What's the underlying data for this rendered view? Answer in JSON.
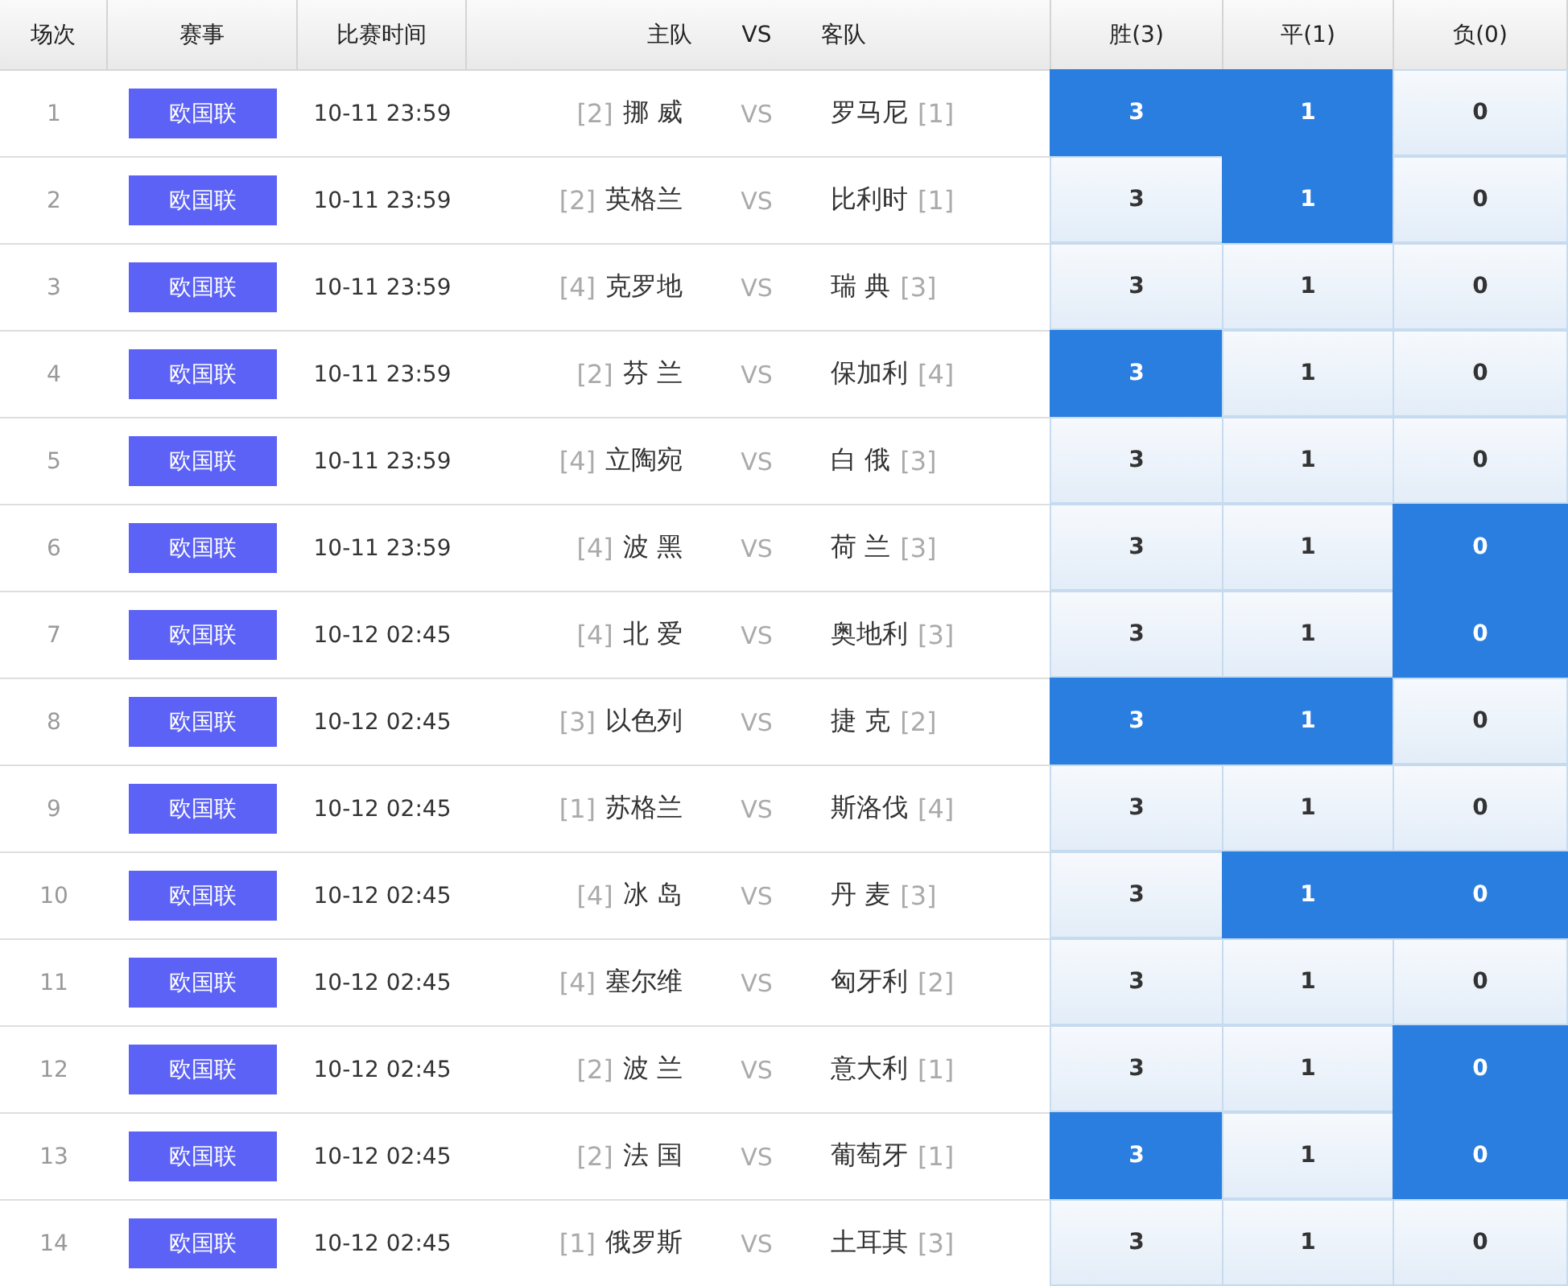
{
  "columns": [
    "场次",
    "赛事",
    "比赛时间",
    "主队",
    "VS",
    "客队",
    "胜(3)",
    "平(1)",
    "负(0)"
  ],
  "rows": [
    {
      "no": "1",
      "league": "欧国联",
      "time": "10-11 23:59",
      "home_rank": "[2]",
      "home": "挪 威",
      "vs": "VS",
      "away": "罗马尼",
      "away_rank": "[1]",
      "options": [
        {
          "label": "3",
          "selected": true
        },
        {
          "label": "1",
          "selected": true
        },
        {
          "label": "0",
          "selected": false
        }
      ]
    },
    {
      "no": "2",
      "league": "欧国联",
      "time": "10-11 23:59",
      "home_rank": "[2]",
      "home": "英格兰",
      "vs": "VS",
      "away": "比利时",
      "away_rank": "[1]",
      "options": [
        {
          "label": "3",
          "selected": false
        },
        {
          "label": "1",
          "selected": true
        },
        {
          "label": "0",
          "selected": false
        }
      ]
    },
    {
      "no": "3",
      "league": "欧国联",
      "time": "10-11 23:59",
      "home_rank": "[4]",
      "home": "克罗地",
      "vs": "VS",
      "away": "瑞 典",
      "away_rank": "[3]",
      "options": [
        {
          "label": "3",
          "selected": false
        },
        {
          "label": "1",
          "selected": false
        },
        {
          "label": "0",
          "selected": false
        }
      ]
    },
    {
      "no": "4",
      "league": "欧国联",
      "time": "10-11 23:59",
      "home_rank": "[2]",
      "home": "芬 兰",
      "vs": "VS",
      "away": "保加利",
      "away_rank": "[4]",
      "options": [
        {
          "label": "3",
          "selected": true
        },
        {
          "label": "1",
          "selected": false
        },
        {
          "label": "0",
          "selected": false
        }
      ]
    },
    {
      "no": "5",
      "league": "欧国联",
      "time": "10-11 23:59",
      "home_rank": "[4]",
      "home": "立陶宛",
      "vs": "VS",
      "away": "白 俄",
      "away_rank": "[3]",
      "options": [
        {
          "label": "3",
          "selected": false
        },
        {
          "label": "1",
          "selected": false
        },
        {
          "label": "0",
          "selected": false
        }
      ]
    },
    {
      "no": "6",
      "league": "欧国联",
      "time": "10-11 23:59",
      "home_rank": "[4]",
      "home": "波 黑",
      "vs": "VS",
      "away": "荷 兰",
      "away_rank": "[3]",
      "options": [
        {
          "label": "3",
          "selected": false
        },
        {
          "label": "1",
          "selected": false
        },
        {
          "label": "0",
          "selected": true
        }
      ]
    },
    {
      "no": "7",
      "league": "欧国联",
      "time": "10-12 02:45",
      "home_rank": "[4]",
      "home": "北 爱",
      "vs": "VS",
      "away": "奥地利",
      "away_rank": "[3]",
      "options": [
        {
          "label": "3",
          "selected": false
        },
        {
          "label": "1",
          "selected": false
        },
        {
          "label": "0",
          "selected": true
        }
      ]
    },
    {
      "no": "8",
      "league": "欧国联",
      "time": "10-12 02:45",
      "home_rank": "[3]",
      "home": "以色列",
      "vs": "VS",
      "away": "捷 克",
      "away_rank": "[2]",
      "options": [
        {
          "label": "3",
          "selected": true
        },
        {
          "label": "1",
          "selected": true
        },
        {
          "label": "0",
          "selected": false
        }
      ]
    },
    {
      "no": "9",
      "league": "欧国联",
      "time": "10-12 02:45",
      "home_rank": "[1]",
      "home": "苏格兰",
      "vs": "VS",
      "away": "斯洛伐",
      "away_rank": "[4]",
      "options": [
        {
          "label": "3",
          "selected": false
        },
        {
          "label": "1",
          "selected": false
        },
        {
          "label": "0",
          "selected": false
        }
      ]
    },
    {
      "no": "10",
      "league": "欧国联",
      "time": "10-12 02:45",
      "home_rank": "[4]",
      "home": "冰 岛",
      "vs": "VS",
      "away": "丹 麦",
      "away_rank": "[3]",
      "options": [
        {
          "label": "3",
          "selected": false
        },
        {
          "label": "1",
          "selected": true
        },
        {
          "label": "0",
          "selected": true
        }
      ]
    },
    {
      "no": "11",
      "league": "欧国联",
      "time": "10-12 02:45",
      "home_rank": "[4]",
      "home": "塞尔维",
      "vs": "VS",
      "away": "匈牙利",
      "away_rank": "[2]",
      "options": [
        {
          "label": "3",
          "selected": false
        },
        {
          "label": "1",
          "selected": false
        },
        {
          "label": "0",
          "selected": false
        }
      ]
    },
    {
      "no": "12",
      "league": "欧国联",
      "time": "10-12 02:45",
      "home_rank": "[2]",
      "home": "波 兰",
      "vs": "VS",
      "away": "意大利",
      "away_rank": "[1]",
      "options": [
        {
          "label": "3",
          "selected": false
        },
        {
          "label": "1",
          "selected": false
        },
        {
          "label": "0",
          "selected": true
        }
      ]
    },
    {
      "no": "13",
      "league": "欧国联",
      "time": "10-12 02:45",
      "home_rank": "[2]",
      "home": "法 国",
      "vs": "VS",
      "away": "葡萄牙",
      "away_rank": "[1]",
      "options": [
        {
          "label": "3",
          "selected": true
        },
        {
          "label": "1",
          "selected": false
        },
        {
          "label": "0",
          "selected": true
        }
      ]
    },
    {
      "no": "14",
      "league": "欧国联",
      "time": "10-12 02:45",
      "home_rank": "[1]",
      "home": "俄罗斯",
      "vs": "VS",
      "away": "土耳其",
      "away_rank": "[3]",
      "options": [
        {
          "label": "3",
          "selected": false
        },
        {
          "label": "1",
          "selected": false
        },
        {
          "label": "0",
          "selected": false
        }
      ]
    }
  ]
}
